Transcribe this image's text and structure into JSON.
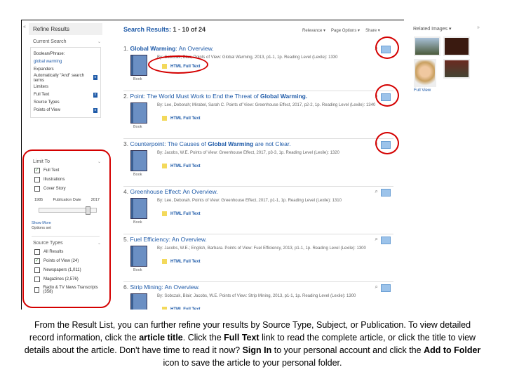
{
  "sidebar": {
    "title": "Refine Results",
    "current_search": "Current Search",
    "boolean_label": "Boolean/Phrase:",
    "boolean_value": "global warming",
    "expanders": "Expanders",
    "expander_item": "Automatically \"And\" search terms",
    "limiters": "Limiters",
    "limiter_item": "Full Text",
    "source_types": "Source Types",
    "source_item": "Points of View",
    "limit_to": "Limit To",
    "limit_options": [
      {
        "label": "Full Text",
        "checked": true
      },
      {
        "label": "Illustrations",
        "checked": false
      },
      {
        "label": "Cover Story",
        "checked": false
      }
    ],
    "date_start": "1985",
    "date_label": "Publication Date",
    "date_end": "2017",
    "show_more": "Show More",
    "options_set": "Options set",
    "source_types_title": "Source Types",
    "source_options": [
      {
        "label": "All Results",
        "checked": false
      },
      {
        "label": "Points of View (24)",
        "checked": true
      },
      {
        "label": "Newspapers (1,011)",
        "checked": false
      },
      {
        "label": "Magazines (2,576)",
        "checked": false
      },
      {
        "label": "Radio & TV News Transcripts (358)",
        "checked": false
      }
    ]
  },
  "results": {
    "heading_label": "Search Results:",
    "heading_range": "1 - 10 of 24",
    "sort": "Relevance ▾",
    "page_options": "Page Options ▾",
    "share": "Share ▾",
    "items": [
      {
        "num": "1.",
        "pre": "",
        "hl": "Global Warming",
        "post": ": An Overview.",
        "by": "By: Sobczak, Blair, Points of View: Global Warming, 2013, p1-1, 1p. Reading Level (Lexile): 1330",
        "type": "Book",
        "full": "HTML Full Text"
      },
      {
        "num": "2.",
        "pre": "Point: The World Must Work to End the Threat of ",
        "hl": "Global Warming.",
        "post": "",
        "by": "By: Lee, Deborah; Mirabel, Sarah C. Points of View: Greenhouse Effect, 2017, p2-2, 1p. Reading Level (Lexile): 1340",
        "type": "Book",
        "full": "HTML Full Text"
      },
      {
        "num": "3.",
        "pre": "Counterpoint: The Causes of ",
        "hl": "Global Warming",
        "post": " are not Clear.",
        "by": "By: Jacobs, W.E. Points of View: Greenhouse Effect, 2017, p3-3, 1p. Reading Level (Lexile): 1320",
        "type": "Book",
        "full": "HTML Full Text"
      },
      {
        "num": "4.",
        "pre": "",
        "hl": "",
        "post": "Greenhouse Effect: An Overview.",
        "by": "By: Lee, Deborah. Points of View: Greenhouse Effect, 2017, p1-1, 1p. Reading Level (Lexile): 1310",
        "type": "Book",
        "full": "HTML Full Text"
      },
      {
        "num": "5.",
        "pre": "",
        "hl": "",
        "post": "Fuel Efficiency: An Overview.",
        "by": "By: Jacobs, W.E.; English, Barbara. Points of View: Fuel Efficiency, 2013, p1-1, 1p. Reading Level (Lexile): 1300",
        "type": "Book",
        "full": "HTML Full Text"
      },
      {
        "num": "6.",
        "pre": "",
        "hl": "",
        "post": "Strip Mining: An Overview.",
        "by": "By: Sobczak, Blair; Jacobs, W.E. Points of View: Strip Mining, 2013, p1-1, 1p. Reading Level (Lexile): 1300",
        "type": "Book",
        "full": "HTML Full Text"
      }
    ]
  },
  "related": {
    "title": "Related Images ▾",
    "more": "Full View"
  },
  "caption": {
    "p1": "From the Result List, you can further refine your results by Source Type, Subject, or Publication. To view detailed record information, click the ",
    "b1": "article title",
    "p2": ". Click the ",
    "b2": "Full Text",
    "p3": " link to read the complete article, or click the title to view details about the article. Don't have time to read it now? ",
    "b3": "Sign In",
    "p4": " to your personal account and click the ",
    "b4": "Add to Folder",
    "p5": " icon to save the article to your personal folder."
  },
  "colors": {
    "accent": "#1e5aa8",
    "annotation": "#d40000"
  }
}
